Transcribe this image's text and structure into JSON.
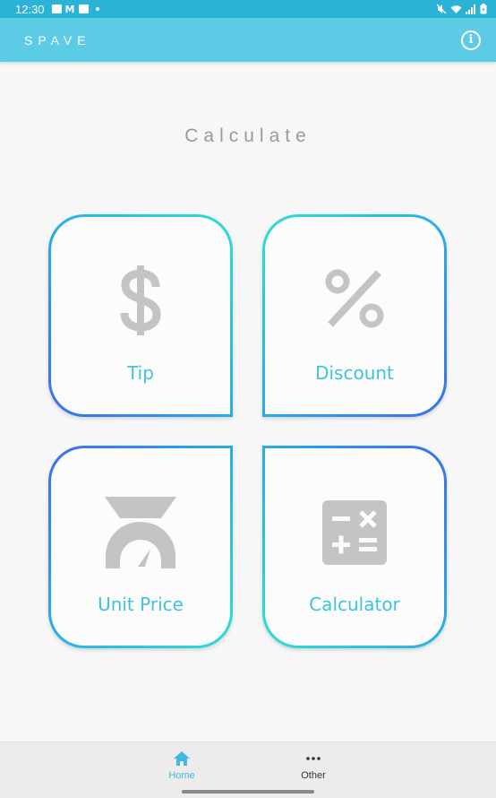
{
  "status_bar": {
    "time": "12:30"
  },
  "app_bar": {
    "title": "SPAVE",
    "info_icon": "info-icon"
  },
  "main": {
    "heading": "Calculate",
    "tiles": [
      {
        "label": "Tip",
        "icon": "dollar-icon"
      },
      {
        "label": "Discount",
        "icon": "percent-icon"
      },
      {
        "label": "Unit Price",
        "icon": "scale-icon"
      },
      {
        "label": "Calculator",
        "icon": "calculator-icon"
      }
    ]
  },
  "bottom_nav": {
    "items": [
      {
        "label": "Home",
        "icon": "home-icon",
        "active": true
      },
      {
        "label": "Other",
        "icon": "more-icon",
        "active": false
      }
    ]
  },
  "colors": {
    "status_bar": "#2ab3d6",
    "app_bar": "#5ccbe6",
    "accent": "#3fc3dc",
    "gradient_start": "#2fdfd3",
    "gradient_end": "#3a6ee6",
    "icon_gray": "#c4c4c4"
  }
}
